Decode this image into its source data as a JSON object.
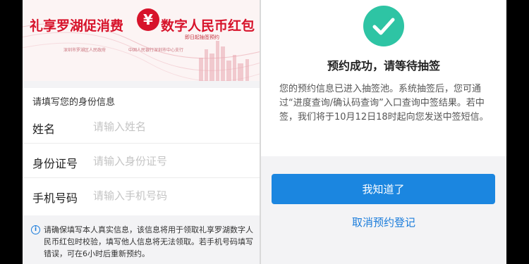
{
  "banner": {
    "title_left": "礼享罗湖促消费",
    "yuan_symbol": "¥",
    "title_right": "数字人民币红包",
    "subtitle": "即日起抽签预约",
    "organizer_text": "深圳市罗湖区人民政府",
    "partner_text": "中国人民银行深圳市中心支行"
  },
  "form": {
    "section_label": "请填写您的身份信息",
    "fields": [
      {
        "label": "姓名",
        "placeholder": "请输入姓名",
        "value": ""
      },
      {
        "label": "身份证号",
        "placeholder": "请输入身份证号",
        "value": ""
      },
      {
        "label": "手机号码",
        "placeholder": "请输入手机号码",
        "value": ""
      }
    ],
    "notice_icon": "i",
    "notice_text": "请确保填写本人真实信息，该信息将用于领取礼享罗湖数字人民币红包时校验，填写他人信息将无法领取。若手机号码填写错误，可在6小时后重新预约。"
  },
  "result": {
    "title": "预约成功，请等待抽签",
    "description": "您的预约信息已进入抽签池。系统抽签后，您可通过“进度查询/确认码查询”入口查询中签结果。若中签，我们将于10月12日18时起向您发送中签短信。",
    "primary_button": "我知道了",
    "cancel_link": "取消预约登记"
  },
  "colors": {
    "brand_red": "#d7132b",
    "success_green": "#2ec4a4",
    "primary_blue": "#1b86e0"
  },
  "icons": {
    "check": "check-circle-icon",
    "info": "info-icon",
    "yuan": "digital-rmb-logo-icon"
  }
}
